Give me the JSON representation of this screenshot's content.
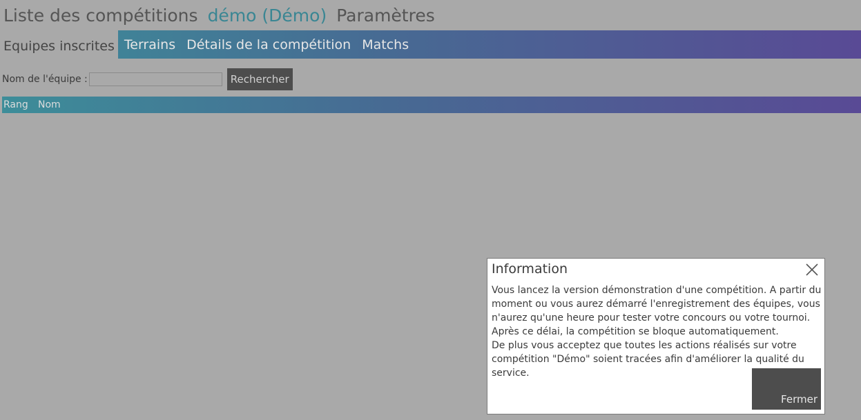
{
  "header": {
    "crumbs": [
      {
        "label": "Liste des compétitions"
      },
      {
        "label": "démo (Démo)"
      },
      {
        "label": "Paramètres"
      }
    ]
  },
  "tabs": [
    {
      "label": "Equipes inscrites",
      "active": true
    },
    {
      "label": "Terrains"
    },
    {
      "label": "Détails de la compétition"
    },
    {
      "label": "Matchs"
    }
  ],
  "search": {
    "label": "Nom de l'équipe :",
    "value": "",
    "button_label": "Rechercher"
  },
  "table": {
    "columns": [
      "Rang",
      "Nom"
    ],
    "rows": []
  },
  "dialog": {
    "title": "Information",
    "close_icon": "close-icon",
    "paragraphs": [
      "Vous lancez la version démonstration d'une compétition. A partir du moment ou vous aurez démarré l'enregistrement des équipes, vous n'aurez qu'une heure pour tester votre concours ou votre tournoi. Après ce délai, la compétition se bloque automatiquement.",
      "De plus vous acceptez que toutes les actions réalisés sur votre compétition \"Démo\" soient tracées afin d'améliorer la qualité du service."
    ],
    "button_label": "Fermer"
  },
  "colors": {
    "gradient_start": "#3d8d99",
    "gradient_end": "#594a95",
    "accent": "#3a8693",
    "button_bg": "#4d4d4d",
    "overlay_bg": "#a9a9a9"
  }
}
